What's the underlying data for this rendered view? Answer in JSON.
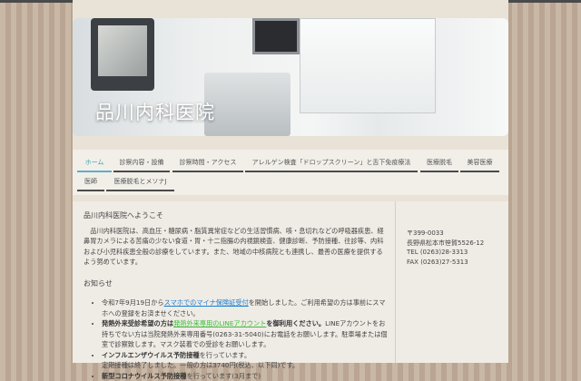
{
  "site": {
    "title": "品川内科医院"
  },
  "nav": [
    "ホーム",
    "診察内容・設備",
    "診察時間・アクセス",
    "アレルゲン検査「ドロップスクリーン」と舌下免疫療法",
    "医療脱毛",
    "美容医療",
    "医師",
    "医療脱毛とメソナJ"
  ],
  "welcome": {
    "heading": "品川内科医院へようこそ",
    "body": "品川内科医院は、高血圧・糖尿病・脂質異常症などの生活習慣病、咳・息切れなどの呼吸器疾患、経鼻胃カメラによる苦痛の少ない食道・胃・十二指腸の内視鏡検査、健康診断、予防接種、往診等、内科および小児科疾患全般の診療をしています。また、地域の中核病院とも連携し、最善の医療を提供するよう努めています。"
  },
  "news": {
    "heading": "お知らせ",
    "item1": {
      "pre": "令和7年9月19日から",
      "link": "スマホでのマイナ保険証受付",
      "post": "を開始しました。ご利用希望の方は事前にスマホへの登録をお済ませください。"
    },
    "item2": {
      "bold1": "発熱外来受診希望の方は",
      "link": "発熱外来専用のLINEアカウント",
      "bold2": "を御利用ください。",
      "post": "LINEアカウントをお持ちでない方は当院発熱外来専用番号(0263-31-5040)にお電話をお願いします。駐車場または個室で診察致します。マスク装着での受診をお願いします。"
    },
    "item3": {
      "bold": "インフルエンザウイルス予防接種",
      "post": "を行っています。",
      "line2": "定期接種は終了しました。一般の方は3740円(税込、以下同)です。"
    },
    "item4": {
      "bold": "新型コロナウイルス予防接種",
      "post": "を行っています(3月まで)"
    }
  },
  "sidebar": {
    "zip": "〒399-0033",
    "address": "長野県松本市笹賀5526-12",
    "tel": "TEL (0263)28-3313",
    "fax": "FAX (0263)27-5313"
  }
}
